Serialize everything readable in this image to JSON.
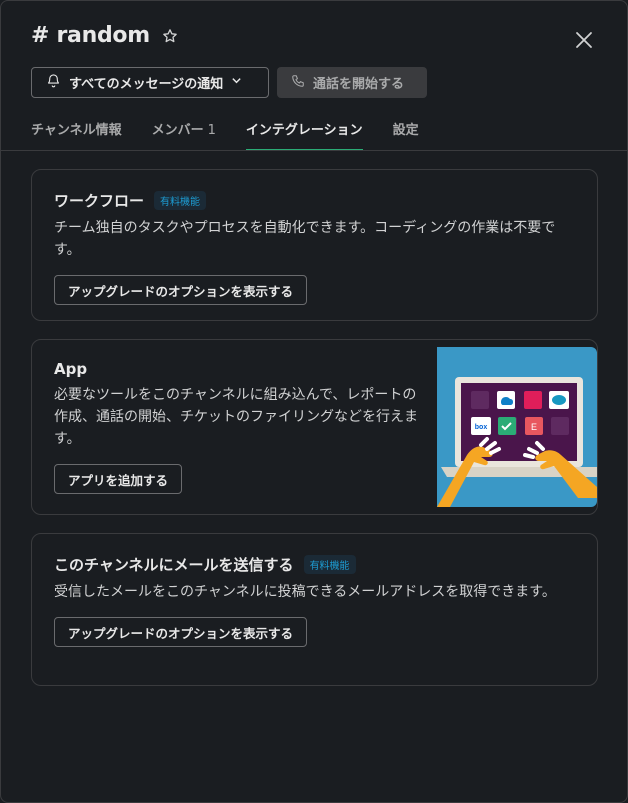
{
  "header": {
    "channel_name": "# random",
    "notif_button_label": "すべてのメッセージの通知",
    "call_button_label": "通話を開始する"
  },
  "tabs": [
    {
      "label": "チャンネル情報",
      "count": ""
    },
    {
      "label": "メンバー",
      "count": "1"
    },
    {
      "label": "インテグレーション",
      "count": ""
    },
    {
      "label": "設定",
      "count": ""
    }
  ],
  "active_tab": "インテグレーション",
  "cards": {
    "workflow": {
      "title": "ワークフロー",
      "badge": "有料機能",
      "description": "チーム独自のタスクやプロセスを自動化できます。コーディングの作業は不要です。",
      "button": "アップグレードのオプションを表示する"
    },
    "app": {
      "title": "App",
      "description": "必要なツールをこのチャンネルに組み込んで、レポートの作成、通話の開始、チケットのファイリングなどを行えます。",
      "button": "アプリを追加する",
      "illustration_labels": {
        "box": "box",
        "e": "E"
      }
    },
    "email": {
      "title": "このチャンネルにメールを送信する",
      "badge": "有料機能",
      "description": "受信したメールをこのチャンネルに投稿できるメールアドレスを取得できます。",
      "button": "アップグレードのオプションを表示する"
    }
  },
  "colors": {
    "background": "#1a1d21",
    "accent_tab": "#2bac76",
    "badge_text": "#1d9bd1",
    "illustration_bg": "#3a98c6"
  }
}
